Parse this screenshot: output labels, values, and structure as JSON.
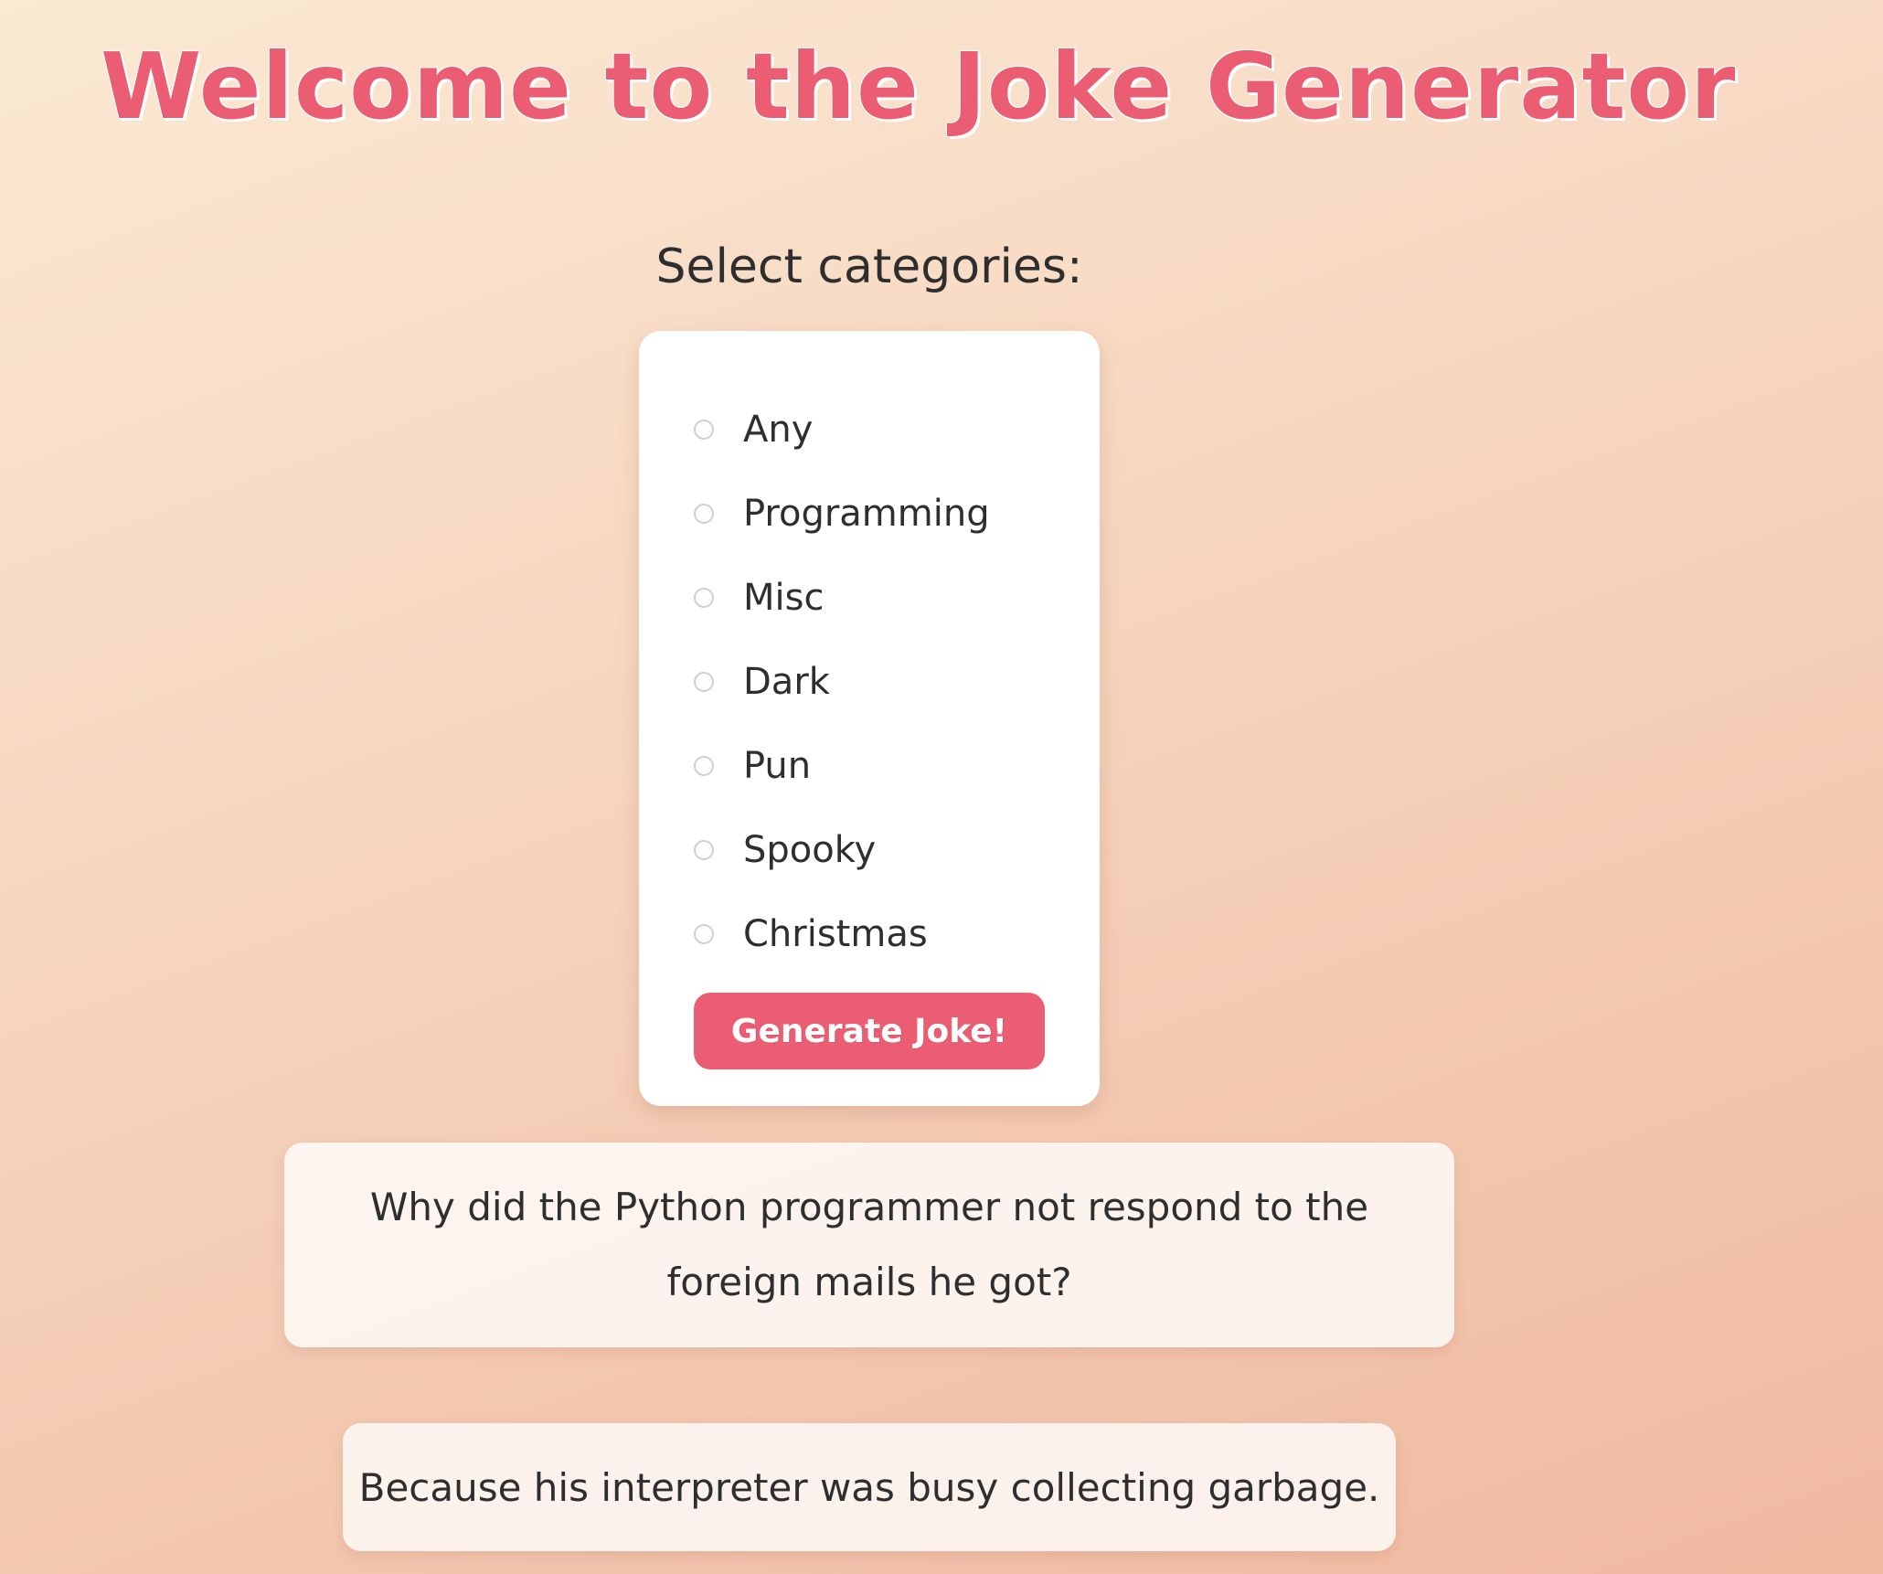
{
  "header": {
    "title": "Welcome to the Joke Generator"
  },
  "categories": {
    "label": "Select categories:",
    "options": [
      {
        "label": "Any",
        "selected": false
      },
      {
        "label": "Programming",
        "selected": false
      },
      {
        "label": "Misc",
        "selected": false
      },
      {
        "label": "Dark",
        "selected": false
      },
      {
        "label": "Pun",
        "selected": false
      },
      {
        "label": "Spooky",
        "selected": false
      },
      {
        "label": "Christmas",
        "selected": false
      }
    ]
  },
  "actions": {
    "generate_label": "Generate Joke!"
  },
  "joke": {
    "setup": "Why did the Python programmer not respond to the foreign mails he got?",
    "delivery": "Because his interpreter was busy collecting garbage."
  },
  "colors": {
    "accent": "#ea5d72",
    "text": "#2e2e2e",
    "card": "#ffffff",
    "background_start": "#fbe9d3",
    "background_end": "#f0b9a0"
  }
}
